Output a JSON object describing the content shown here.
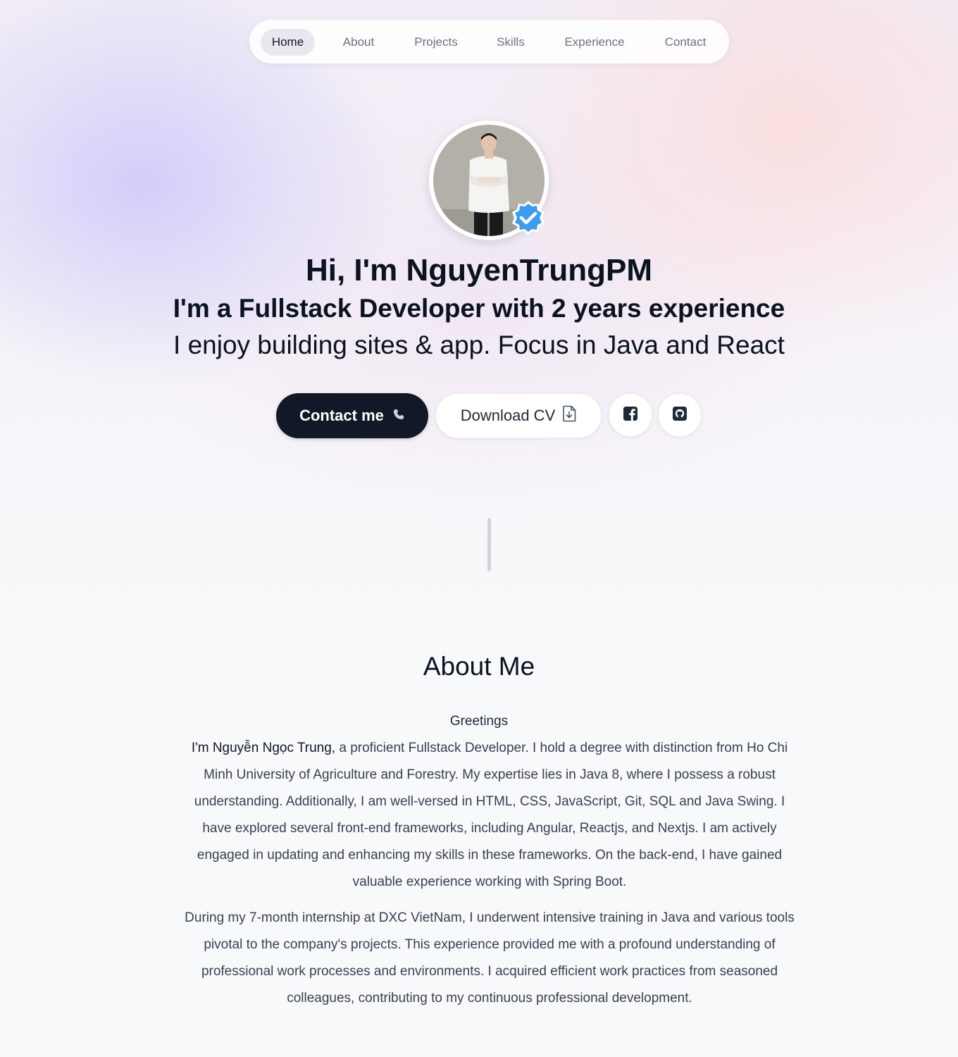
{
  "nav": {
    "items": [
      {
        "label": "Home",
        "active": true
      },
      {
        "label": "About",
        "active": false
      },
      {
        "label": "Projects",
        "active": false
      },
      {
        "label": "Skills",
        "active": false
      },
      {
        "label": "Experience",
        "active": false
      },
      {
        "label": "Contact",
        "active": false
      }
    ]
  },
  "hero": {
    "greeting": "Hi, I'm NguyenTrungPM",
    "role": "I'm a Fullstack Developer with 2 years experience",
    "tagline": "I enjoy building sites & app. Focus in Java and React",
    "contact_button": "Contact me",
    "contact_icon": "phone-icon",
    "cv_button": "Download CV",
    "cv_icon": "file-download-icon",
    "social": [
      "facebook-icon",
      "github-icon"
    ],
    "avatar_badge": "verified-check-icon"
  },
  "about": {
    "title": "About Me",
    "greeting": "Greetings",
    "intro_name": "I'm Nguyễn Ngọc Trung,",
    "paragraph1_rest": " a proficient Fullstack Developer. I hold a degree with distinction from Ho Chi Minh University of Agriculture and Forestry. My expertise lies in Java 8, where I possess a robust understanding. Additionally, I am well-versed in HTML, CSS, JavaScript, Git, SQL and Java Swing. I have explored several front-end frameworks, including Angular, Reactjs, and Nextjs. I am actively engaged in updating and enhancing my skills in these frameworks. On the back-end, I have gained valuable experience working with Spring Boot.",
    "paragraph2": "During my 7-month internship at DXC VietNam, I underwent intensive training in Java and various tools pivotal to the company's projects. This experience provided me with a profound understanding of professional work processes and environments. I acquired efficient work practices from seasoned colleagues, contributing to my continuous professional development."
  },
  "colors": {
    "primary_dark": "#111827",
    "badge_blue": "#3b9cf0",
    "nav_active_bg": "#e8e9ee",
    "muted_text": "#6b7280"
  }
}
